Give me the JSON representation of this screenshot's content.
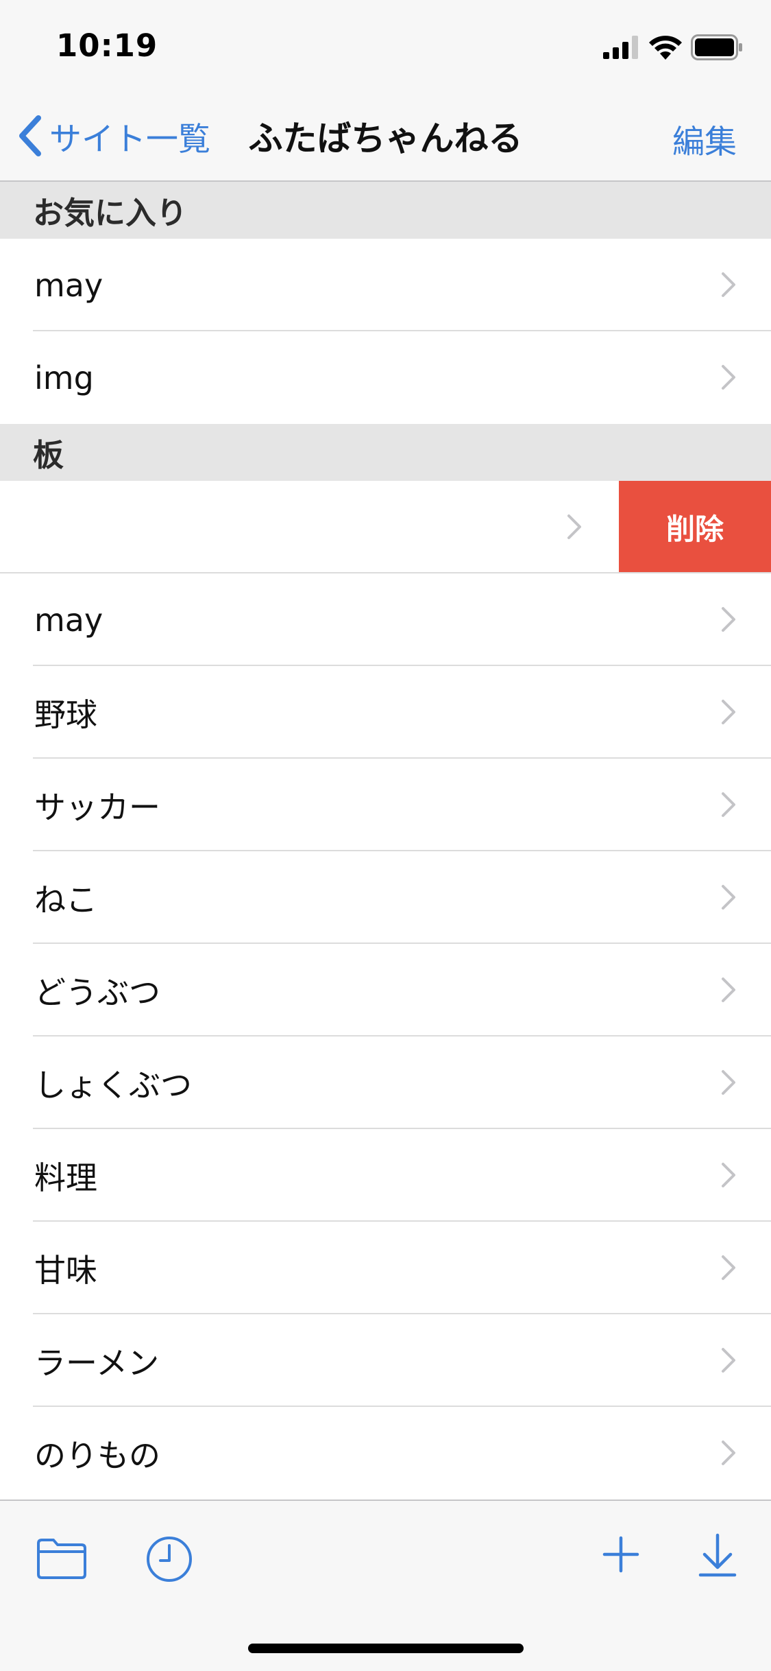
{
  "status_bar": {
    "time": "10:19",
    "icons": [
      "cellular-signal-icon",
      "wifi-icon",
      "battery-icon"
    ]
  },
  "nav_bar": {
    "back_label": "サイト一覧",
    "title": "ふたばちゃんねる",
    "edit_label": "編集"
  },
  "sections": {
    "favorites": {
      "header": "お気に入り",
      "rows": [
        {
          "label": "may"
        },
        {
          "label": "img"
        }
      ]
    },
    "boards": {
      "header": "板",
      "swiped_row": {
        "label": "",
        "delete_label": "削除"
      },
      "rows": [
        {
          "label": "may"
        },
        {
          "label": "野球"
        },
        {
          "label": "サッカー"
        },
        {
          "label": "ねこ"
        },
        {
          "label": "どうぶつ"
        },
        {
          "label": "しょくぶつ"
        },
        {
          "label": "料理"
        },
        {
          "label": "甘味"
        },
        {
          "label": "ラーメン"
        },
        {
          "label": "のりもの"
        }
      ]
    }
  },
  "toolbar": {
    "icons": [
      "folder-icon",
      "history-clock-icon",
      "add-icon",
      "download-icon"
    ]
  },
  "colors": {
    "accent": "#3b7fd9",
    "delete": "#e9503f",
    "section_header_bg": "#e5e5e5",
    "bar_bg": "#f7f7f7"
  }
}
